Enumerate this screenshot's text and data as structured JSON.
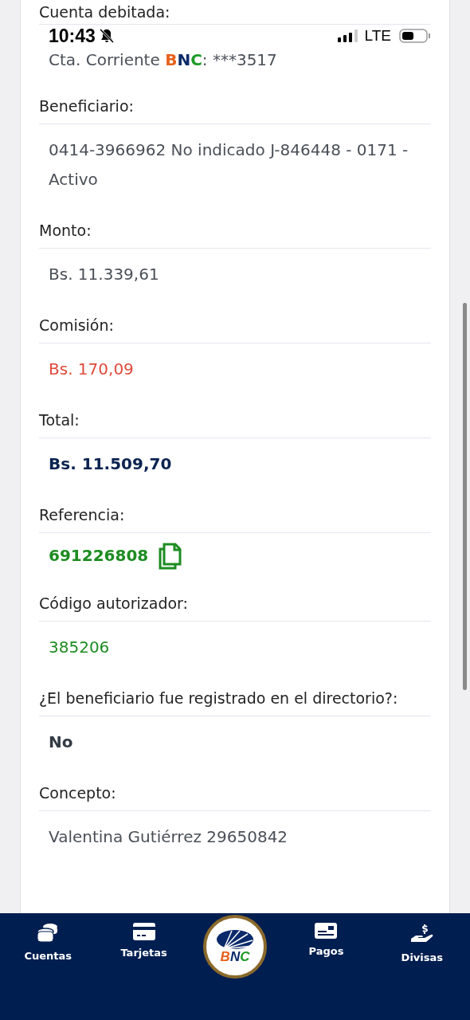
{
  "first_field": {
    "label": "Cuenta debitada:",
    "value_parts": [
      {
        "text": "Cta. Corriente ",
        "color": "#4a4f57"
      },
      {
        "text": "B",
        "color": "#e8601c"
      },
      {
        "text": "N",
        "color": "#0b2a6b"
      },
      {
        "text": "C",
        "color": "#1e9a28"
      },
      {
        "text": ": ***3517",
        "color": "#4a4f57"
      }
    ]
  },
  "status_bar": {
    "time": "10:43",
    "network": "LTE"
  },
  "fields": [
    {
      "label": "Beneficiario:",
      "value": "0414-3966962 No indicado J-846448 - 0171 - Activo",
      "kind": "plain"
    },
    {
      "label": "Monto:",
      "value": "Bs. 11.339,61",
      "kind": "plain"
    },
    {
      "label": "Comisión:",
      "value": "Bs. 170,09",
      "kind": "negative"
    },
    {
      "label": "Total:",
      "value": "Bs. 11.509,70",
      "kind": "total"
    },
    {
      "label": "Referencia:",
      "value": "691226808",
      "kind": "reference"
    },
    {
      "label": "Código autorizador:",
      "value": "385206",
      "kind": "code"
    },
    {
      "label": "¿El beneficiario fue registrado en el directorio?:",
      "value": "No",
      "kind": "answer"
    },
    {
      "label": "Concepto:",
      "value": "Valentina Gutiérrez 29650842",
      "kind": "plain"
    }
  ],
  "bottom_nav": [
    {
      "label": "Cuentas",
      "kind": "tab"
    },
    {
      "label": "Tarjetas",
      "kind": "tab"
    },
    {
      "kind": "logo",
      "logo_letters": [
        {
          "text": "B",
          "color": "#e8601c"
        },
        {
          "text": "N",
          "color": "#0b2a6b"
        },
        {
          "text": "C",
          "color": "#1e9a28"
        }
      ]
    },
    {
      "label": "Pagos",
      "kind": "tab"
    },
    {
      "label": "Divisas",
      "kind": "tab"
    }
  ]
}
